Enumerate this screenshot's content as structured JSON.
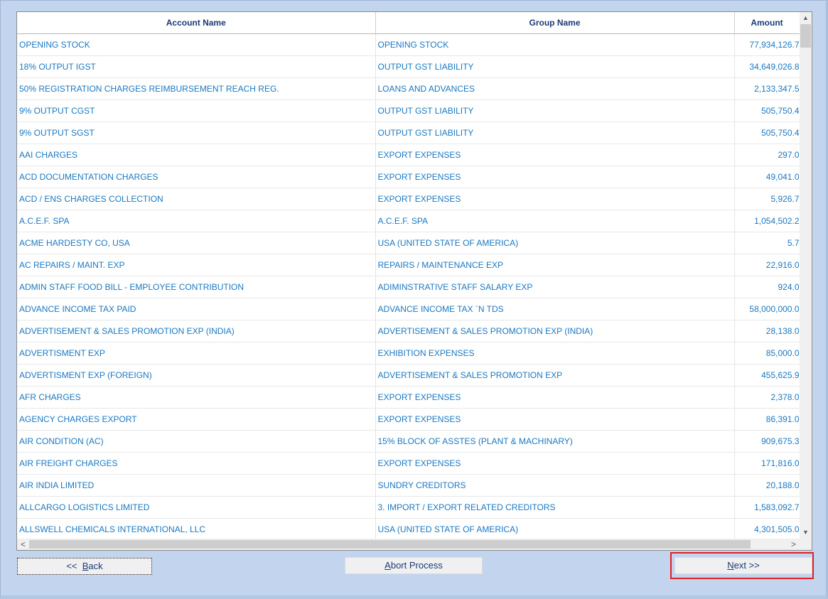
{
  "columns": [
    "Account Name",
    "Group Name",
    "Amount"
  ],
  "rows": [
    [
      "OPENING STOCK",
      "OPENING STOCK",
      "77,934,126.7"
    ],
    [
      "18% OUTPUT IGST",
      "OUTPUT GST LIABILITY",
      "34,649,026.8"
    ],
    [
      "50% REGISTRATION CHARGES REIMBURSEMENT REACH REG.",
      "LOANS AND ADVANCES",
      "2,133,347.5"
    ],
    [
      "9% OUTPUT CGST",
      "OUTPUT GST LIABILITY",
      "505,750.4"
    ],
    [
      "9% OUTPUT SGST",
      "OUTPUT GST LIABILITY",
      "505,750.4"
    ],
    [
      "AAI CHARGES",
      "EXPORT EXPENSES",
      "297.0"
    ],
    [
      "ACD DOCUMENTATION CHARGES",
      "EXPORT EXPENSES",
      "49,041.0"
    ],
    [
      "ACD / ENS CHARGES COLLECTION",
      "EXPORT EXPENSES",
      "5,926.7"
    ],
    [
      "A.C.E.F. SPA",
      "A.C.E.F. SPA",
      "1,054,502.2"
    ],
    [
      "ACME HARDESTY CO, USA",
      "USA (UNITED STATE OF AMERICA)",
      "5.7"
    ],
    [
      "AC REPAIRS / MAINT. EXP",
      "REPAIRS / MAINTENANCE EXP",
      "22,916.0"
    ],
    [
      "ADMIN STAFF FOOD BILL - EMPLOYEE CONTRIBUTION",
      "ADIMINSTRATIVE STAFF SALARY EXP",
      "924.0"
    ],
    [
      "ADVANCE INCOME TAX PAID",
      "ADVANCE INCOME TAX `N TDS",
      "58,000,000.0"
    ],
    [
      "ADVERTISEMENT & SALES PROMOTION EXP (INDIA)",
      "ADVERTISEMENT & SALES PROMOTION EXP (INDIA)",
      "28,138.0"
    ],
    [
      "ADVERTISMENT EXP",
      "EXHIBITION EXPENSES",
      "85,000.0"
    ],
    [
      "ADVERTISMENT EXP (FOREIGN)",
      "ADVERTISEMENT & SALES PROMOTION EXP",
      "455,625.9"
    ],
    [
      "AFR CHARGES",
      "EXPORT EXPENSES",
      "2,378.0"
    ],
    [
      "AGENCY CHARGES EXPORT",
      "EXPORT EXPENSES",
      "86,391.0"
    ],
    [
      "AIR CONDITION (AC)",
      "15% BLOCK OF ASSTES (PLANT & MACHINARY)",
      "909,675.3"
    ],
    [
      "AIR FREIGHT CHARGES",
      "EXPORT EXPENSES",
      "171,816.0"
    ],
    [
      "AIR INDIA LIMITED",
      "SUNDRY CREDITORS",
      "20,188.0"
    ],
    [
      "ALLCARGO LOGISTICS LIMITED",
      "3. IMPORT / EXPORT RELATED CREDITORS",
      "1,583,092.7"
    ],
    [
      "ALLSWELL CHEMICALS INTERNATIONAL, LLC",
      "USA (UNITED STATE OF AMERICA)",
      "4,301,505.0"
    ]
  ],
  "buttons": {
    "back_prefix": "<<  ",
    "back_key": "B",
    "back_rest": "ack",
    "abort_key": "A",
    "abort_rest": "bort Process",
    "next_key": "N",
    "next_rest": "ext >>"
  },
  "icons": {
    "scroll_up": "▲",
    "scroll_down": "▼",
    "scroll_left": "<",
    "scroll_right": ">"
  }
}
